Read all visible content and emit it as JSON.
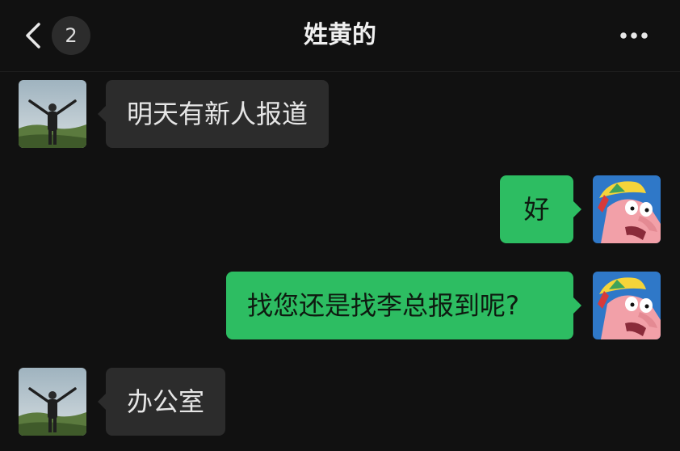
{
  "header": {
    "title": "姓黄的",
    "unread_count": "2",
    "back_icon": "chevron-left-icon",
    "more_icon": "more-horizontal-icon"
  },
  "colors": {
    "background": "#111111",
    "incoming_bubble": "#2c2c2c",
    "outgoing_bubble": "#2dbd62"
  },
  "messages": [
    {
      "direction": "incoming",
      "text": "明天有新人报道"
    },
    {
      "direction": "outgoing",
      "text": "好"
    },
    {
      "direction": "outgoing",
      "text": "找您还是找李总报到呢?"
    },
    {
      "direction": "incoming",
      "text": "办公室"
    }
  ]
}
